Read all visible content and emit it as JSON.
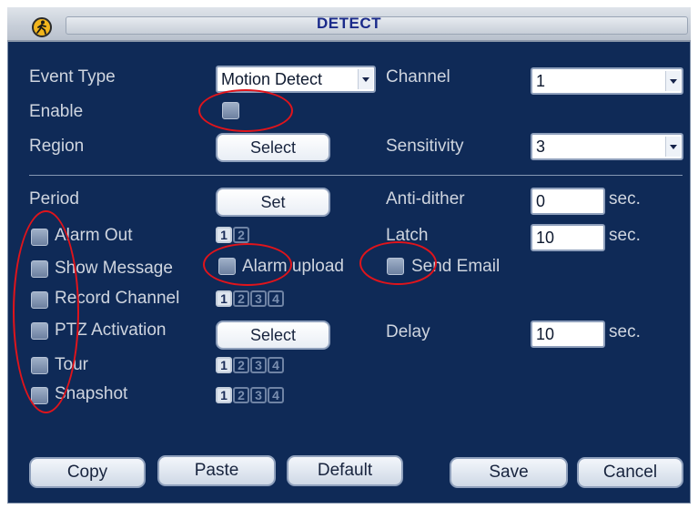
{
  "window": {
    "title": "DETECT"
  },
  "event_type": {
    "label": "Event Type",
    "value": "Motion Detect"
  },
  "channel": {
    "label": "Channel",
    "value": "1"
  },
  "enable": {
    "label": "Enable"
  },
  "region": {
    "label": "Region",
    "button": "Select"
  },
  "sensitivity": {
    "label": "Sensitivity",
    "value": "3"
  },
  "period": {
    "label": "Period",
    "button": "Set"
  },
  "anti_dither": {
    "label": "Anti-dither",
    "value": "0",
    "unit": "sec."
  },
  "alarm_out": {
    "label": "Alarm Out",
    "channels": [
      "1",
      "2"
    ]
  },
  "latch": {
    "label": "Latch",
    "value": "10",
    "unit": "sec."
  },
  "show_message": {
    "label": "Show Message"
  },
  "alarm_upload": {
    "label": "Alarm upload"
  },
  "send_email": {
    "label": "Send Email"
  },
  "record_channel": {
    "label": "Record Channel",
    "channels": [
      "1",
      "2",
      "3",
      "4"
    ]
  },
  "ptz_activation": {
    "label": "PTZ Activation",
    "button": "Select"
  },
  "delay": {
    "label": "Delay",
    "value": "10",
    "unit": "sec."
  },
  "tour": {
    "label": "Tour",
    "channels": [
      "1",
      "2",
      "3",
      "4"
    ]
  },
  "snapshot": {
    "label": "Snapshot",
    "channels": [
      "1",
      "2",
      "3",
      "4"
    ]
  },
  "buttons": {
    "copy": "Copy",
    "paste": "Paste",
    "default": "Default",
    "save": "Save",
    "cancel": "Cancel"
  },
  "colors": {
    "panel": "#0f2a57",
    "text": "#cfd5df",
    "title": "#1a2a8a",
    "annotation": "#e0141b"
  },
  "icons": {
    "logo": "person-walking-icon",
    "dropdown": "chevron-down-icon"
  }
}
